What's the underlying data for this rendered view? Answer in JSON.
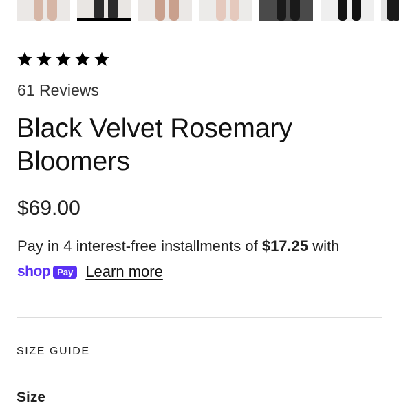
{
  "gallery": {
    "thumbnails": [
      {
        "name": "thumbnail-1",
        "bg": "#ebe8e6",
        "legs": "#d6b6a6"
      },
      {
        "name": "thumbnail-2",
        "bg": "#e9e6e3",
        "legs": "#2b2b2b"
      },
      {
        "name": "thumbnail-3",
        "bg": "#ebe8e6",
        "legs": "#c9a08d"
      },
      {
        "name": "thumbnail-4",
        "bg": "#ecebe9",
        "legs": "#e5c9bd"
      },
      {
        "name": "thumbnail-5",
        "bg": "#4a4a4a",
        "legs": "#1a1a1a"
      },
      {
        "name": "thumbnail-6",
        "bg": "#efefef",
        "legs": "#111111"
      },
      {
        "name": "thumbnail-7",
        "bg": "#e6e6e6",
        "legs": "#1a1a1a"
      }
    ],
    "selected_index": 1
  },
  "rating": {
    "stars": 5,
    "max_stars": 5,
    "reviews_text": "61 Reviews"
  },
  "product": {
    "title": "Black Velvet Rosemary Bloomers",
    "price": "$69.00"
  },
  "installments": {
    "prefix": "Pay in 4 interest-free installments of ",
    "amount": "$17.25",
    "suffix": " with",
    "shop_word": "shop",
    "pay_badge": "Pay",
    "learn_more": "Learn more",
    "brand_color": "#5a31f4"
  },
  "size_guide": "SIZE GUIDE",
  "size_label": "Size"
}
